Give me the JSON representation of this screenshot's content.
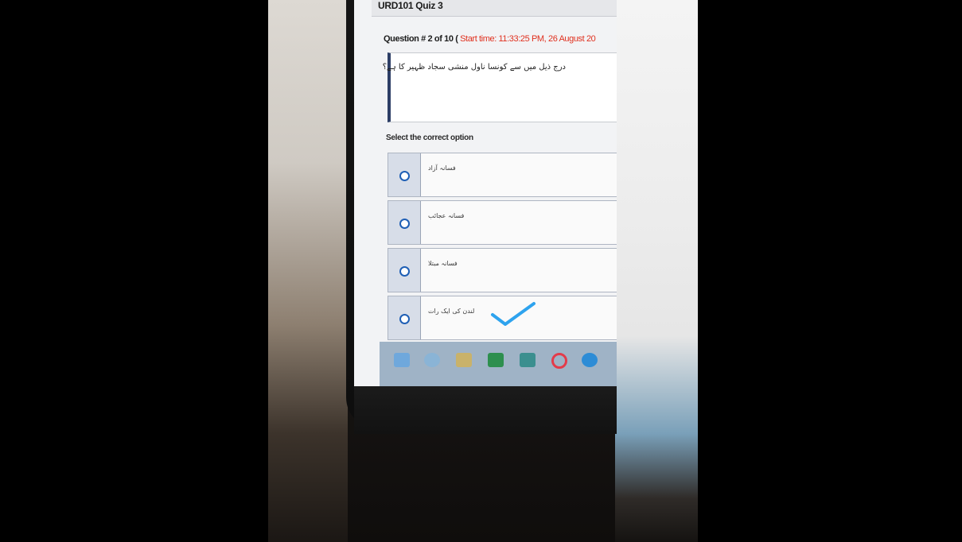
{
  "quiz": {
    "title": "URD101 Quiz 3",
    "question_number": "Question # 2 of 10 (",
    "start_time": "Start time: 11:33:25 PM, 26 August 20",
    "question_text": "درج ذیل میں سے کونسا ناول منشی سجاد ظہیر کا ہے؟",
    "select_label": "Select the correct option",
    "options": [
      {
        "label": "فسانہ آزاد"
      },
      {
        "label": "فسانہ عجائب"
      },
      {
        "label": "فسانہ مبتلا"
      },
      {
        "label": "لندن کی ایک رات"
      }
    ],
    "selected_hint_icon": "checkmark-icon"
  },
  "taskbar": {
    "icons": [
      "windows-start-icon",
      "ie-icon",
      "file-explorer-icon",
      "excel-icon",
      "video-icon",
      "opera-icon",
      "chrome-icon"
    ],
    "colors": {
      "windows": "#6fa8dc",
      "ie": "#8ab4d6",
      "explorer": "#c9b26a",
      "excel": "#2d8f4e",
      "video": "#3b8f8f",
      "opera": "#e33b4a",
      "chrome": "#2d8cd6"
    }
  },
  "colors": {
    "accent_red": "#e0301e",
    "border_blue": "#2d3e66",
    "check_blue": "#2ea3ee"
  }
}
